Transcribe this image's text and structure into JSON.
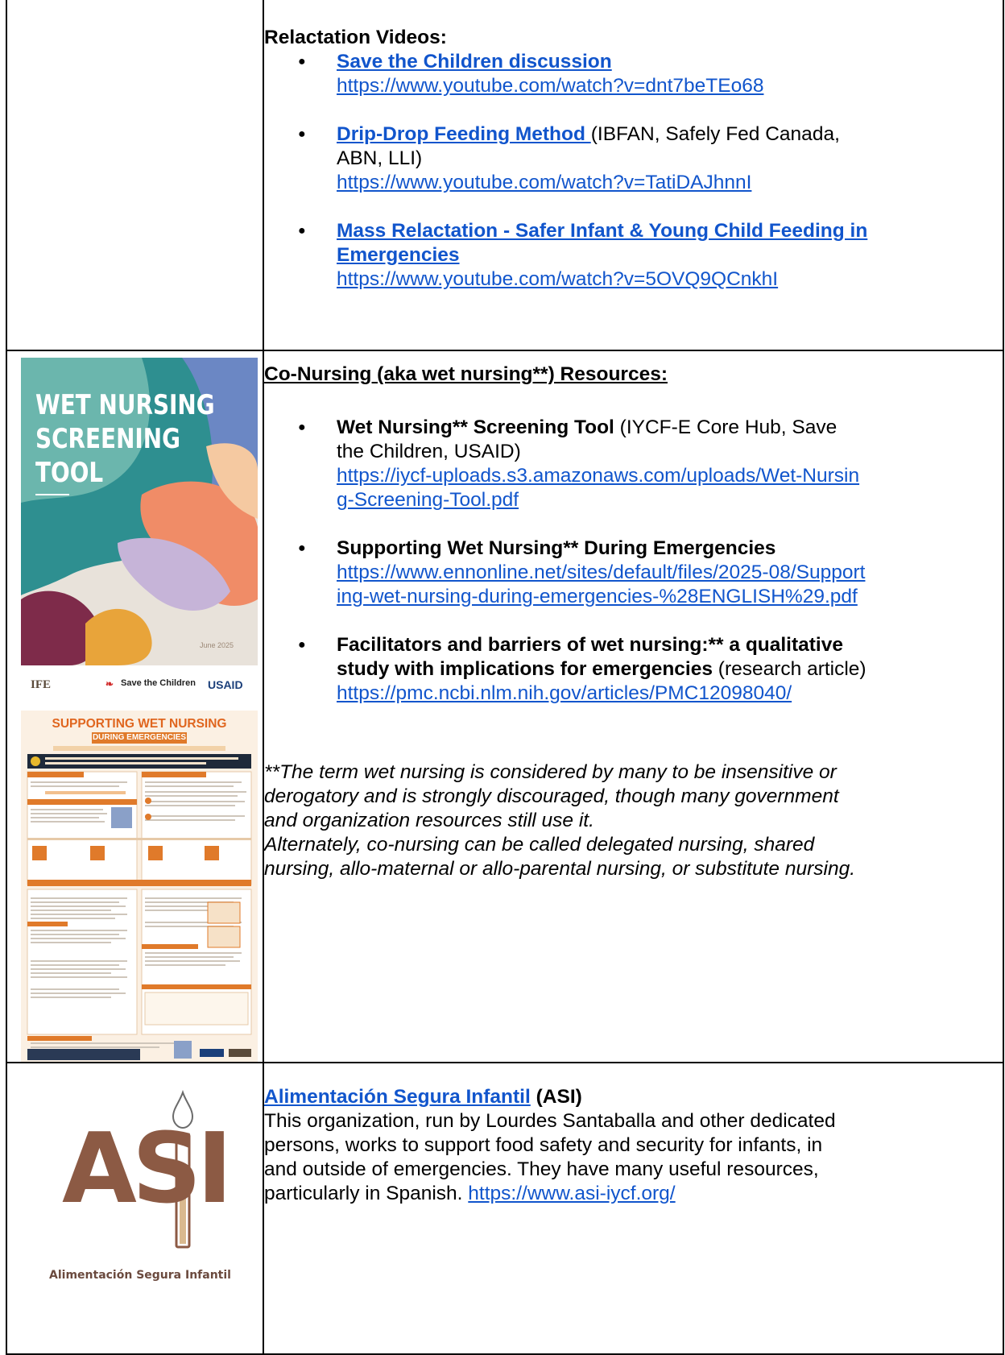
{
  "row1": {
    "heading": "Relactation Videos:",
    "items": [
      {
        "title": "Save the Children discussion",
        "url": "https://www.youtube.com/watch?v=dnt7beTEo68"
      },
      {
        "title": "Drip-Drop Feeding Method ",
        "note_line1": "(IBFAN, Safely Fed Canada,",
        "note_line2": "ABN, LLI)",
        "url": "https://www.youtube.com/watch?v=TatiDAJhnnI"
      },
      {
        "title_line1": "Mass Relactation - Safer Infant & Young Child Feeding in",
        "title_line2": "Emergencies",
        "url": "https://www.youtube.com/watch?v=5OVQ9QCnkhI"
      }
    ]
  },
  "row2": {
    "heading": "Co-Nursing (aka wet nursing**) Resources:",
    "poster1": {
      "title_l1": "WET NURSING",
      "title_l2": "SCREENING",
      "title_l3": "TOOL",
      "date": "June 2025",
      "logo1": "IFE",
      "logo2": "Save the Children",
      "logo3": "USAID"
    },
    "poster2": {
      "title": "SUPPORTING WET NURSING",
      "subtitle": "DURING EMERGENCIES"
    },
    "items": [
      {
        "bold": "Wet Nursing** Screening Tool",
        "rest_l1": " (IYCF-E Core Hub, Save",
        "rest_l2": "the Children, USAID)",
        "url_l1": "https://iycf-uploads.s3.amazonaws.com/uploads/Wet-Nursin",
        "url_l2": "g-Screening-Tool.pdf"
      },
      {
        "bold": "Supporting Wet Nursing** During Emergencies",
        "url_l1": "https://www.ennonline.net/sites/default/files/2025-08/Support",
        "url_l2": "ing-wet-nursing-during-emergencies-%28ENGLISH%29.pdf"
      },
      {
        "bold_l1": "Facilitators and barriers of wet nursing:** a qualitative",
        "bold_l2": "study with implications for emergencies",
        "rest": " (research article)",
        "url": "https://pmc.ncbi.nlm.nih.gov/articles/PMC12098040/"
      }
    ],
    "note_lines": [
      "**The term wet nursing is considered by many to be insensitive or",
      "derogatory and is strongly discouraged, though many government",
      "and organization resources still use it.",
      "Alternately, co-nursing can be called delegated nursing, shared",
      "nursing, allo-maternal or allo-parental nursing, or substitute nursing."
    ]
  },
  "row3": {
    "logo_letters": "ASI",
    "logo_caption": "Alimentación Segura Infantil",
    "title_link": "Alimentación Segura Infantil",
    "title_suffix": " (ASI)",
    "lines": [
      "This organization, run by Lourdes Santaballa and other dedicated",
      "persons, works to support food safety and security for infants, in",
      "and outside of emergencies. They have many useful resources,"
    ],
    "last_line_text": "particularly in Spanish. ",
    "url": "https://www.asi-iycf.org/"
  }
}
